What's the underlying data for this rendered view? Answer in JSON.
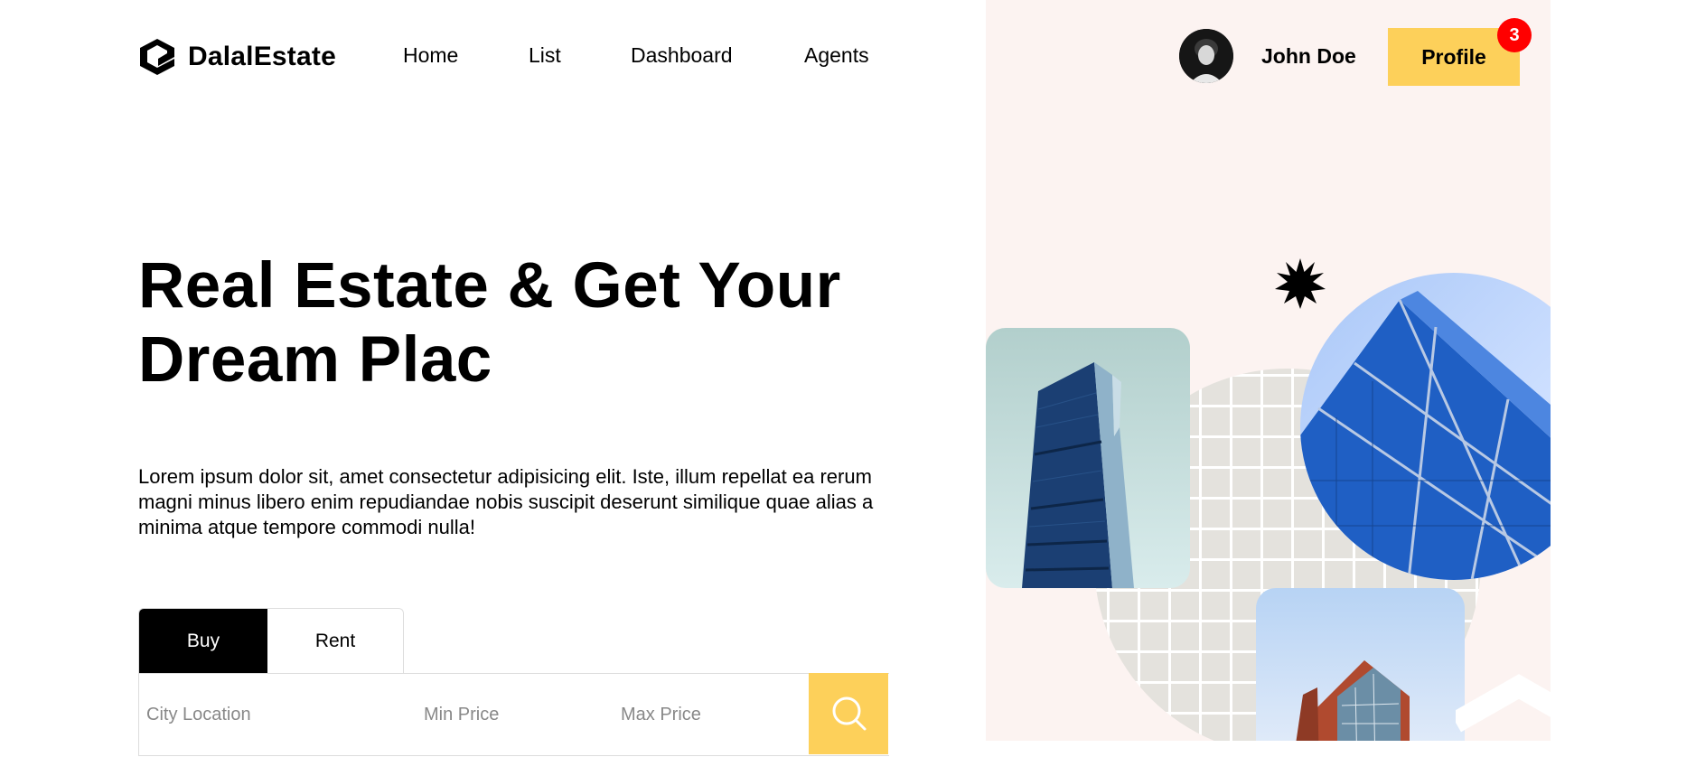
{
  "brand": {
    "name": "DalalEstate"
  },
  "nav": {
    "links": [
      "Home",
      "List",
      "Dashboard",
      "Agents"
    ]
  },
  "user": {
    "name": "John Doe",
    "profile_label": "Profile",
    "notifications": "3"
  },
  "hero": {
    "title": "Real Estate & Get Your Dream Plac",
    "description": "Lorem ipsum dolor sit, amet consectetur adipisicing elit. Iste, illum repellat ea rerum magni minus libero enim repudiandae nobis suscipit deserunt similique quae alias a minima atque tempore commodi nulla!"
  },
  "search": {
    "tabs": [
      "Buy",
      "Rent"
    ],
    "active_tab": "Buy",
    "city_placeholder": "City Location",
    "min_placeholder": "Min Price",
    "max_placeholder": "Max Price"
  },
  "colors": {
    "accent": "#fdd05a",
    "panel_bg": "#fcf3f1",
    "badge": "#ff0000",
    "active_tab": "#000000"
  }
}
